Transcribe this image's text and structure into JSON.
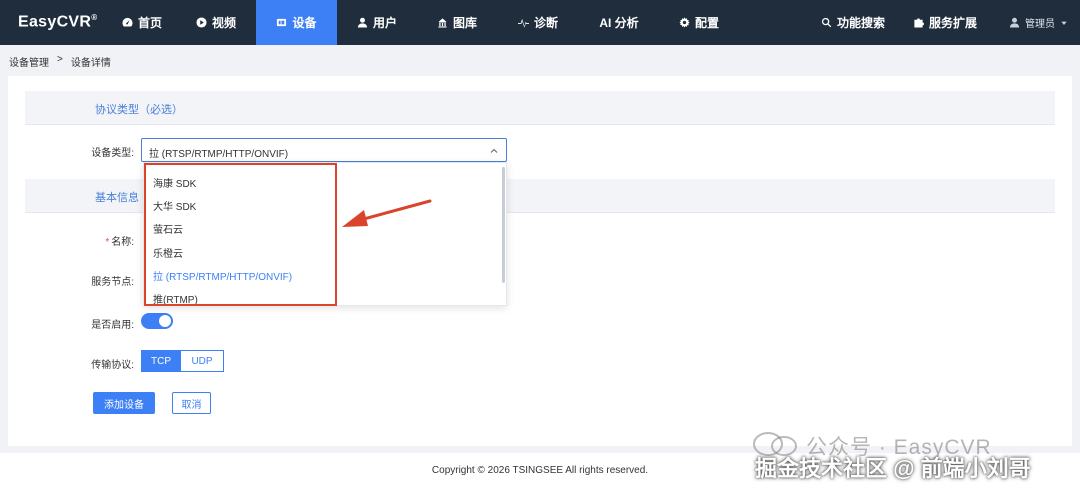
{
  "app": {
    "logo": "EasyCVR",
    "logo_mark": "®"
  },
  "nav": {
    "items": [
      {
        "label": "首页",
        "icon": "dashboard-icon"
      },
      {
        "label": "视频",
        "icon": "play-icon"
      },
      {
        "label": "设备",
        "icon": "device-icon",
        "active": true
      },
      {
        "label": "用户",
        "icon": "user-icon"
      },
      {
        "label": "图库",
        "icon": "image-icon"
      },
      {
        "label": "诊断",
        "icon": "pulse-icon"
      },
      {
        "label": "AI 分析",
        "icon": ""
      },
      {
        "label": "配置",
        "icon": "gear-icon"
      }
    ],
    "right": [
      {
        "label": "功能搜索",
        "icon": "search-icon"
      },
      {
        "label": "服务扩展",
        "icon": "puzzle-icon"
      }
    ],
    "user": "管理员"
  },
  "breadcrumb": {
    "root": "设备管理",
    "separator": ">",
    "current": "设备详情"
  },
  "form": {
    "section_protocol": "协议类型（必选）",
    "section_basic": "基本信息",
    "device_type_label": "设备类型:",
    "device_type_value": "拉 (RTSP/RTMP/HTTP/ONVIF)",
    "required_mark": "*",
    "name_label": "名称:",
    "node_label": "服务节点:",
    "enabled_label": "是否启用:",
    "enabled": true,
    "transport_label": "传输协议:",
    "transport_options": [
      "TCP",
      "UDP"
    ],
    "transport_selected": "TCP",
    "submit": "添加设备",
    "cancel": "取消"
  },
  "dropdown": {
    "options": [
      "海康 SDK",
      "大华 SDK",
      "萤石云",
      "乐橙云",
      "拉 (RTSP/RTMP/HTTP/ONVIF)",
      "推(RTMP)"
    ],
    "selected_index": 4
  },
  "annotation_color": "#d9442b",
  "accent": "#3d7ff5",
  "footer": "Copyright © 2026 TSINGSEE All rights reserved.",
  "watermark": {
    "line1": "公众号 · EasyCVR",
    "line2": "掘金技术社区 @ 前端小刘哥"
  }
}
